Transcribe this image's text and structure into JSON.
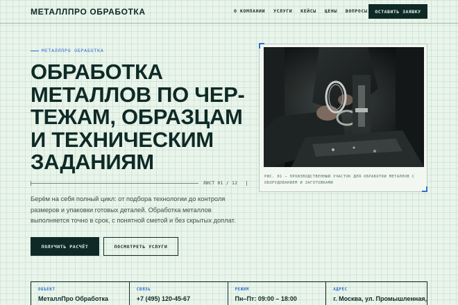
{
  "header": {
    "logo": "МЕТАЛЛПРО ОБРАБОТКА",
    "nav": [
      "О КОМПАНИИ",
      "УСЛУГИ",
      "КЕЙСЫ",
      "ЦЕНЫ",
      "ВОПРОСЫ"
    ],
    "cta_label": "ОСТАВИТЬ ЗАЯВКУ"
  },
  "hero": {
    "eyebrow": "МЕТАЛЛПРО ОБРАБОТКА",
    "title_lines": [
      "ОБРАБОТКА",
      "МЕТАЛЛОВ ПО ЧЕР-",
      "ТЕЖАМ, ОБРАЗЦАМ",
      "И ТЕХНИЧЕСКИМ",
      "ЗАДАНИЯМ"
    ],
    "sheet": "ЛИСТ 01 / 12",
    "description": "Берём на себя полный цикл: от подбора технологии до контроля размеров и упаковки готовых деталей. Обработка металлов выполняется точно в срок, с понятной сметой и без скрытых доплат.",
    "primary_button": "ПОЛУЧИТЬ РАСЧЁТ",
    "secondary_button": "ПОСМОТРЕТЬ УСЛУГИ"
  },
  "figure": {
    "caption": "РИС. 01 — ПРОИЗВОДСТВЕННЫЙ УЧАСТОК ДЛЯ ОБРАБОТКИ МЕТАЛЛОВ С ОБОРУДОВАНИЕМ И ЗАГОТОВКАМИ"
  },
  "info": [
    {
      "label": "ОБЪЕКТ",
      "value": "МеталлПро Обработка"
    },
    {
      "label": "СВЯЗЬ",
      "value": "+7 (495) 120-45-67"
    },
    {
      "label": "РЕЖИМ",
      "value": "Пн–Пт: 09:00 – 18:00"
    },
    {
      "label": "АДРЕС",
      "value": "г. Москва, ул. Промышленная,"
    }
  ],
  "colors": {
    "accent": "#2f6fd1",
    "dark": "#0f2a26",
    "background": "#e9f4ea"
  }
}
